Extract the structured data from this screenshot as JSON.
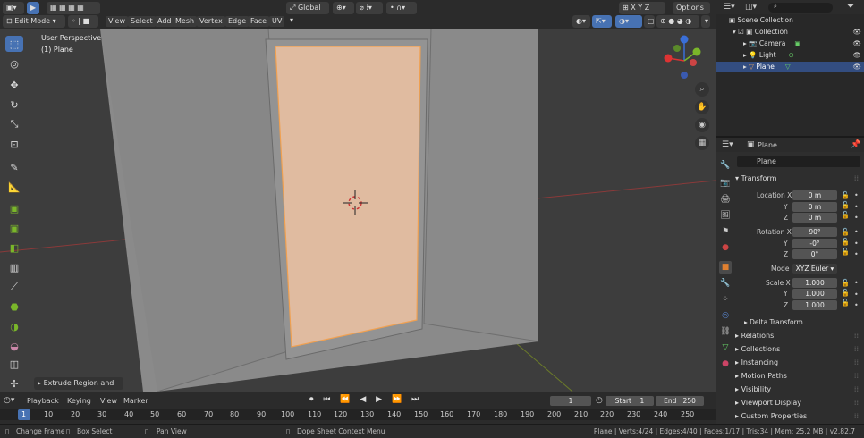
{
  "header": {
    "mode_label": "Edit Mode",
    "menus": [
      "View",
      "Select",
      "Add",
      "Mesh",
      "Vertex",
      "Edge",
      "Face",
      "UV"
    ],
    "transform_orientation": "Global",
    "options_label": "Options",
    "axes": [
      "X",
      "Y",
      "Z"
    ]
  },
  "viewport": {
    "perspective_label": "User Perspective",
    "object_label": "(1) Plane",
    "operator_panel": "Extrude Region and Mo"
  },
  "timeline": {
    "menus": [
      "Playback",
      "Keying",
      "View",
      "Marker"
    ],
    "current_frame": "1",
    "start_label": "Start",
    "start_value": "1",
    "end_label": "End",
    "end_value": "250",
    "ruler": [
      "1",
      "10",
      "20",
      "30",
      "40",
      "50",
      "60",
      "70",
      "80",
      "90",
      "100",
      "110",
      "120",
      "130",
      "140",
      "150",
      "160",
      "170",
      "180",
      "190",
      "200",
      "210",
      "220",
      "230",
      "240",
      "250"
    ]
  },
  "statusbar": {
    "left1": "Change Frame",
    "left2": "Box Select",
    "left3": "Pan View",
    "middle": "Dope Sheet Context Menu",
    "stats": "Plane | Verts:4/24 | Edges:4/40 | Faces:1/17 | Tris:34 | Mem: 25.2 MB | v2.82.7"
  },
  "outliner": {
    "search_placeholder": "",
    "items": [
      {
        "label": "Scene Collection"
      },
      {
        "label": "Collection"
      },
      {
        "label": "Camera"
      },
      {
        "label": "Light"
      },
      {
        "label": "Plane"
      }
    ]
  },
  "properties": {
    "object_name": "Plane",
    "data_name": "Plane",
    "transform_title": "Transform",
    "location_label": "Location X",
    "loc": [
      "0 m",
      "0 m",
      "0 m"
    ],
    "rotation_label": "Rotation X",
    "rot": [
      "90°",
      "-0°",
      "0°"
    ],
    "mode_label": "Mode",
    "mode_value": "XYZ Euler",
    "scale_label": "Scale X",
    "scale": [
      "1.000",
      "1.000",
      "1.000"
    ],
    "axis_y": "Y",
    "axis_z": "Z",
    "delta_transform": "Delta Transform",
    "sections": [
      "Relations",
      "Collections",
      "Instancing",
      "Motion Paths",
      "Visibility",
      "Viewport Display",
      "Custom Properties"
    ]
  },
  "colors": {
    "accent": "#4772b3",
    "face_selected": "#e0bba0",
    "viewport_bg": "#3d3d3d"
  }
}
